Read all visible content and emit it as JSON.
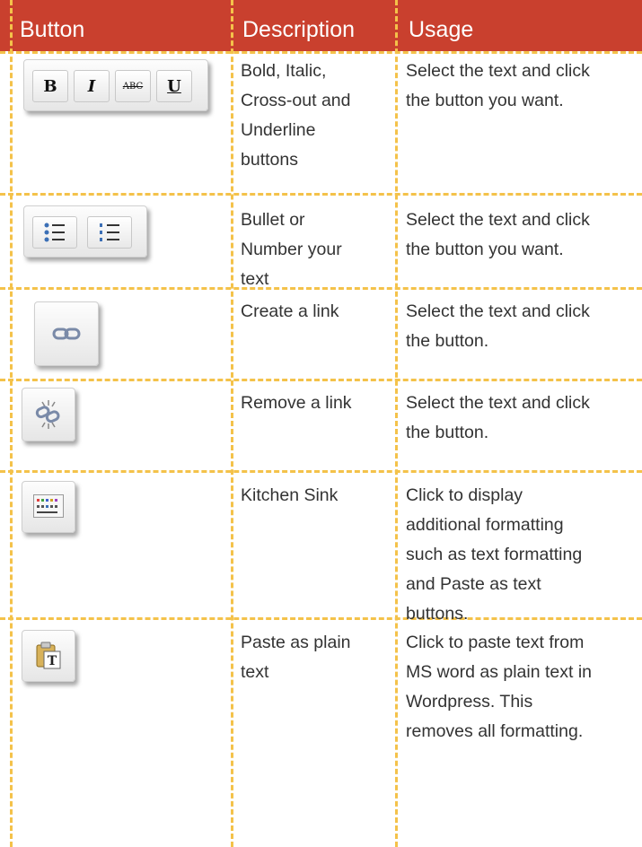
{
  "header": {
    "button": "Button",
    "description": "Description",
    "usage": "Usage"
  },
  "rows": [
    {
      "description": [
        "Bold, Italic,",
        "Cross-out and",
        "Underline",
        "buttons"
      ],
      "usage": [
        "Select the text and click",
        "the button you want."
      ],
      "icons": [
        {
          "name": "bold-icon",
          "glyph": "B"
        },
        {
          "name": "italic-icon",
          "glyph": "I"
        },
        {
          "name": "strikethrough-icon",
          "glyph": "ABC"
        },
        {
          "name": "underline-icon",
          "glyph": "U"
        }
      ]
    },
    {
      "description": [
        "Bullet or",
        "Number your",
        "text"
      ],
      "usage": [
        "Select the text and click",
        "the button you want."
      ],
      "icons": [
        {
          "name": "bullet-list-icon"
        },
        {
          "name": "numbered-list-icon"
        }
      ]
    },
    {
      "description": [
        "Create a link"
      ],
      "usage": [
        "Select the text and click",
        "the button."
      ],
      "icons": [
        {
          "name": "link-icon"
        }
      ]
    },
    {
      "description": [
        "Remove a link"
      ],
      "usage": [
        "Select the text and click",
        "the button."
      ],
      "icons": [
        {
          "name": "unlink-icon"
        }
      ]
    },
    {
      "description": [
        "Kitchen Sink"
      ],
      "usage": [
        "Click to display",
        "additional formatting",
        "such as text formatting",
        "and Paste as text",
        "buttons."
      ],
      "icons": [
        {
          "name": "kitchen-sink-icon"
        }
      ]
    },
    {
      "description": [
        "Paste as plain",
        "text"
      ],
      "usage": [
        "Click to paste text from",
        "MS word as plain text in",
        "Wordpress. This",
        "removes all formatting."
      ],
      "icons": [
        {
          "name": "paste-as-text-icon",
          "glyph": "T"
        }
      ]
    }
  ],
  "colors": {
    "header_bg": "#c9402e",
    "grid": "#f4c24a",
    "text": "#333333"
  }
}
